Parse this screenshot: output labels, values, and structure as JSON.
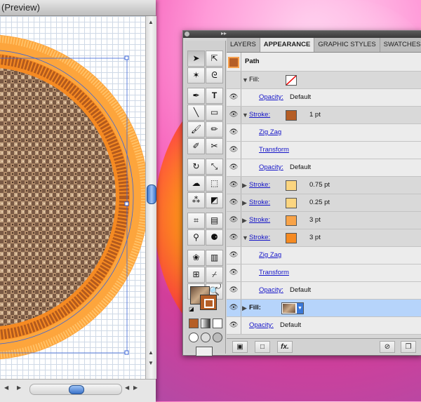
{
  "document": {
    "title": "(Preview)"
  },
  "panel": {
    "tabs": [
      {
        "label": "LAYERS"
      },
      {
        "label": "APPEARANCE"
      },
      {
        "label": "GRAPHIC STYLES"
      },
      {
        "label": "SWATCHES"
      }
    ],
    "path_label": "Path",
    "rows": [
      {
        "label": "Fill:",
        "kind": "fill-none"
      },
      {
        "label": "Opacity:",
        "value": "Default"
      },
      {
        "label": "Stroke:",
        "value": "1 pt",
        "color": "#b55e26"
      },
      {
        "label": "Zig Zag"
      },
      {
        "label": "Transform"
      },
      {
        "label": "Opacity:",
        "value": "Default"
      },
      {
        "label": "Stroke:",
        "value": "0.75 pt",
        "color": "#fbd580"
      },
      {
        "label": "Stroke:",
        "value": "0.25 pt",
        "color": "#fbd580"
      },
      {
        "label": "Stroke:",
        "value": "3 pt",
        "color": "#f8a348"
      },
      {
        "label": "Stroke:",
        "value": "3 pt",
        "color": "#f58a22"
      },
      {
        "label": "Zig Zag"
      },
      {
        "label": "Transform"
      },
      {
        "label": "Opacity:",
        "value": "Default"
      },
      {
        "label": "Fill:",
        "kind": "pattern"
      },
      {
        "label": "Opacity:",
        "value": "Default"
      }
    ],
    "fx_label": "fx."
  }
}
